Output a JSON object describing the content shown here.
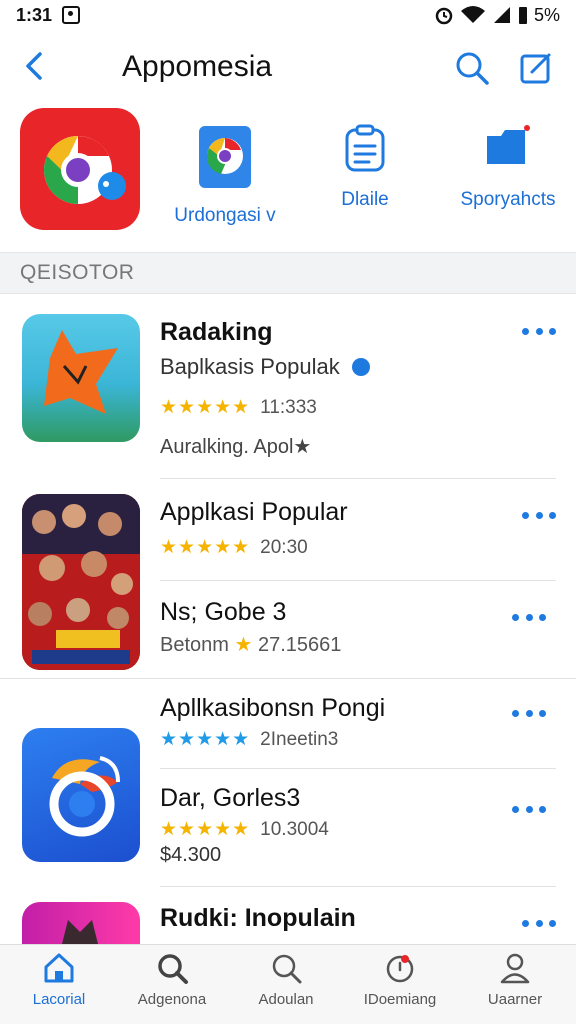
{
  "status_bar": {
    "time": "1:31",
    "battery": "5%"
  },
  "header": {
    "title": "Appomesia",
    "back_icon": "chevron-left-icon",
    "search_icon": "search-icon",
    "compose_icon": "compose-icon"
  },
  "featured": {
    "items": [
      {
        "label": "Urdongasi v",
        "icon": "chrome-icon"
      },
      {
        "label": "Dlaile",
        "icon": "clipboard-icon"
      },
      {
        "label": "Sporyahcts",
        "icon": "folder-icon"
      }
    ]
  },
  "section": {
    "title": "QEISOTOR"
  },
  "apps": [
    {
      "title": "Radaking",
      "subtitle": "Baplkasis Populak",
      "stars": "★★★★★",
      "rating": "11:333",
      "note": "Auralking. Apol★"
    },
    {
      "title": "Applkasi Popular",
      "stars": "★★★★★",
      "rating": "20:30"
    },
    {
      "title": "Ns; Gobe 3",
      "note_prefix": "Betonm",
      "note_star": "★",
      "note_num": "27.15661"
    },
    {
      "title": "Apllkasibonsn Pongi",
      "stars": "★★★★★",
      "rating": "2Ineetin3"
    },
    {
      "title": "Dar, Gorles3",
      "stars": "★★★★★",
      "rating": "10.3004",
      "price": "$4.300"
    },
    {
      "title": "Rudki: Inopulain"
    }
  ],
  "bottom_nav": {
    "items": [
      {
        "label": "Lacorial",
        "icon": "home-icon"
      },
      {
        "label": "Adgenona",
        "icon": "search-icon"
      },
      {
        "label": "Adoulan",
        "icon": "search-icon"
      },
      {
        "label": "IDoemiang",
        "icon": "updates-icon"
      },
      {
        "label": "Uaarner",
        "icon": "person-icon"
      }
    ]
  },
  "colors": {
    "accent": "#1f7ae0",
    "star_gold": "#f5b400",
    "star_blue": "#1f9be8"
  }
}
